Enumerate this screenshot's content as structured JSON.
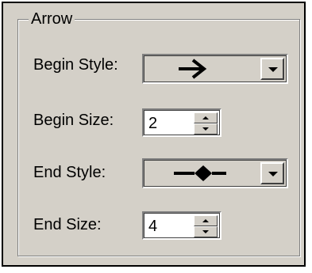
{
  "group": {
    "title": "Arrow"
  },
  "begin_style": {
    "label": "Begin Style:",
    "selected_icon": "right-arrow-icon"
  },
  "begin_size": {
    "label": "Begin Size:",
    "value": "2"
  },
  "end_style": {
    "label": "End Style:",
    "selected_icon": "diamond-line-end-icon"
  },
  "end_size": {
    "label": "End Size:",
    "value": "4"
  },
  "colors": {
    "face": "#d4d0c8",
    "border": "#000000",
    "field": "#ffffff"
  }
}
